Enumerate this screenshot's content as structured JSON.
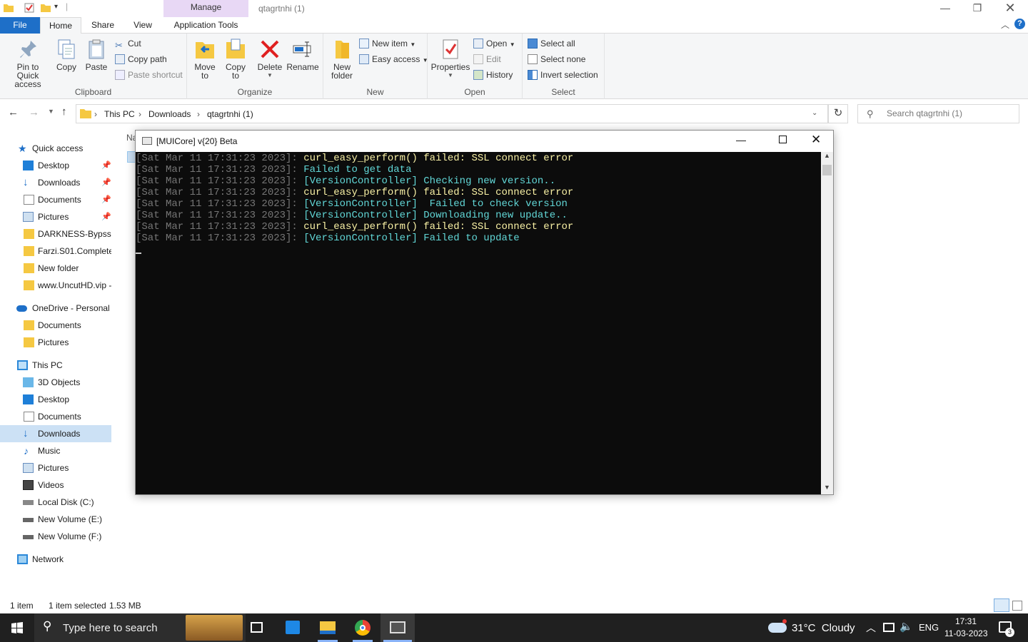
{
  "explorer": {
    "manage_tab": "Manage",
    "title": "qtagrtnhi (1)",
    "tabs": {
      "file": "File",
      "home": "Home",
      "share": "Share",
      "view": "View",
      "app_tools": "Application Tools"
    },
    "ribbon": {
      "clipboard": {
        "label": "Clipboard",
        "pin": "Pin to Quick access",
        "copy": "Copy",
        "paste": "Paste",
        "cut": "Cut",
        "copy_path": "Copy path",
        "paste_shortcut": "Paste shortcut"
      },
      "organize": {
        "label": "Organize",
        "move_to": "Move to",
        "copy_to": "Copy to",
        "delete": "Delete",
        "rename": "Rename"
      },
      "new": {
        "label": "New",
        "new_folder": "New folder",
        "new_item": "New item",
        "easy_access": "Easy access"
      },
      "open": {
        "label": "Open",
        "properties": "Properties",
        "open": "Open",
        "edit": "Edit",
        "history": "History"
      },
      "select": {
        "label": "Select",
        "select_all": "Select all",
        "select_none": "Select none",
        "invert": "Invert selection"
      }
    },
    "address": {
      "this_pc": "This PC",
      "downloads": "Downloads",
      "folder": "qtagrtnhi (1)"
    },
    "search_placeholder": "Search qtagrtnhi (1)",
    "column_header_partial": "Na",
    "nav": {
      "quick_access": "Quick access",
      "desktop": "Desktop",
      "downloads": "Downloads",
      "documents": "Documents",
      "pictures": "Pictures",
      "darkness": "DARKNESS-Bypss",
      "farzi": "Farzi.S01.Complete.",
      "new_folder": "New folder",
      "uncut": "www.UncutHD.vip -",
      "onedrive": "OneDrive - Personal",
      "od_documents": "Documents",
      "od_pictures": "Pictures",
      "this_pc": "This PC",
      "objects3d": "3D Objects",
      "pc_desktop": "Desktop",
      "pc_documents": "Documents",
      "pc_downloads": "Downloads",
      "music": "Music",
      "pc_pictures": "Pictures",
      "videos": "Videos",
      "local_c": "Local Disk (C:)",
      "vol_e": "New Volume (E:)",
      "vol_f": "New Volume (F:)",
      "network": "Network"
    },
    "status": {
      "items": "1 item",
      "selected": "1 item selected",
      "size": "1.53 MB"
    }
  },
  "console": {
    "title": "[MUICore] v{20} Beta",
    "lines": [
      {
        "ts": "[Sat Mar 11 17:31:23 2023]: ",
        "msg": "curl_easy_perform() failed: SSL connect error",
        "color": "#f9f1a5"
      },
      {
        "ts": "[Sat Mar 11 17:31:23 2023]: ",
        "msg": "Failed to get data",
        "color": "#61d6d6"
      },
      {
        "ts": "[Sat Mar 11 17:31:23 2023]: ",
        "msg": "[VersionController] Checking new version..",
        "color": "#61d6d6"
      },
      {
        "ts": "[Sat Mar 11 17:31:23 2023]: ",
        "msg": "curl_easy_perform() failed: SSL connect error",
        "color": "#f9f1a5"
      },
      {
        "ts": "[Sat Mar 11 17:31:23 2023]: ",
        "msg": "[VersionController]  Failed to check version",
        "color": "#61d6d6"
      },
      {
        "ts": "[Sat Mar 11 17:31:23 2023]: ",
        "msg": "[VersionController] Downloading new update..",
        "color": "#61d6d6"
      },
      {
        "ts": "[Sat Mar 11 17:31:23 2023]: ",
        "msg": "curl_easy_perform() failed: SSL connect error",
        "color": "#f9f1a5"
      },
      {
        "ts": "[Sat Mar 11 17:31:23 2023]: ",
        "msg": "[VersionController] Failed to update",
        "color": "#61d6d6"
      }
    ]
  },
  "taskbar": {
    "search_placeholder": "Type here to search",
    "weather": "31°C  Cloudy",
    "lang": "ENG",
    "time": "17:31",
    "date": "11-03-2023",
    "notif_count": "3"
  },
  "colors": {
    "accent": "#1e6fc8",
    "manage_tab": "#e8d8f5",
    "nav_selected": "#cce1f5",
    "console_bg": "#0c0c0c",
    "taskbar": "#202020"
  }
}
